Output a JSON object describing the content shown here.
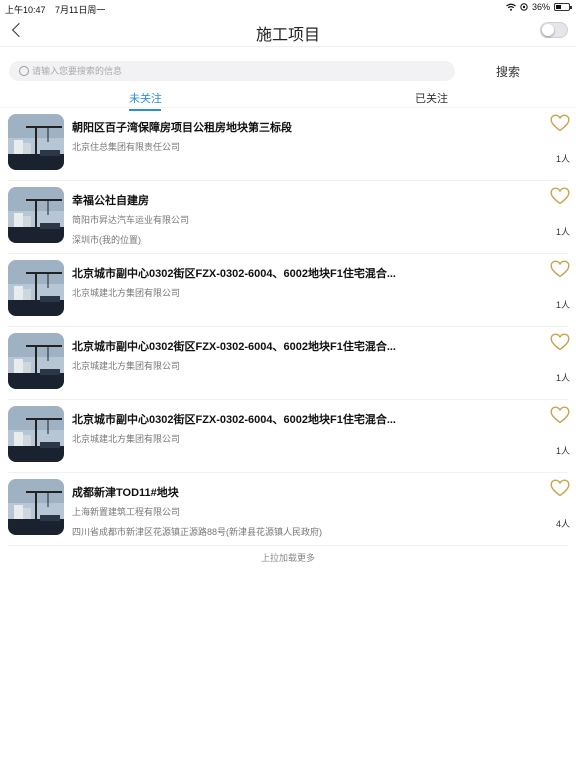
{
  "status_bar": {
    "time": "上午10:47",
    "date": "7月11日周一",
    "battery": "36%"
  },
  "nav": {
    "title": "施工项目"
  },
  "search": {
    "placeholder": "请输入您要搜索的信息",
    "value": "",
    "button_label": "搜索"
  },
  "tabs": [
    {
      "label": "未关注",
      "active": true
    },
    {
      "label": "已关注",
      "active": false
    }
  ],
  "colors": {
    "accent": "#2a8fd6",
    "heart": "#c9a24a"
  },
  "icons": {
    "back": "chevron-left-icon",
    "heart": "heart-outline-icon",
    "search": "search-icon"
  },
  "projects": [
    {
      "title": "朝阳区百子湾保障房项目公租房地块第三标段",
      "company": "北京住总集团有限责任公司",
      "location": "",
      "count": "1人"
    },
    {
      "title": "幸福公社自建房",
      "company": "简阳市昇达汽车运业有限公司",
      "location": "深圳市(我的位置)",
      "count": "1人"
    },
    {
      "title": "北京城市副中心0302街区FZX-0302-6004、6002地块F1住宅混合...",
      "company": "北京城建北方集团有限公司",
      "location": "",
      "count": "1人"
    },
    {
      "title": "北京城市副中心0302街区FZX-0302-6004、6002地块F1住宅混合...",
      "company": "北京城建北方集团有限公司",
      "location": "",
      "count": "1人"
    },
    {
      "title": "北京城市副中心0302街区FZX-0302-6004、6002地块F1住宅混合...",
      "company": "北京城建北方集团有限公司",
      "location": "",
      "count": "1人"
    },
    {
      "title": "成都新津TOD11#地块",
      "company": "上海新置建筑工程有限公司",
      "location": "四川省成都市新津区花源镇正源路88号(新津县花源镇人民政府)",
      "count": "4人"
    }
  ],
  "footer": {
    "load_more": "上拉加载更多"
  }
}
